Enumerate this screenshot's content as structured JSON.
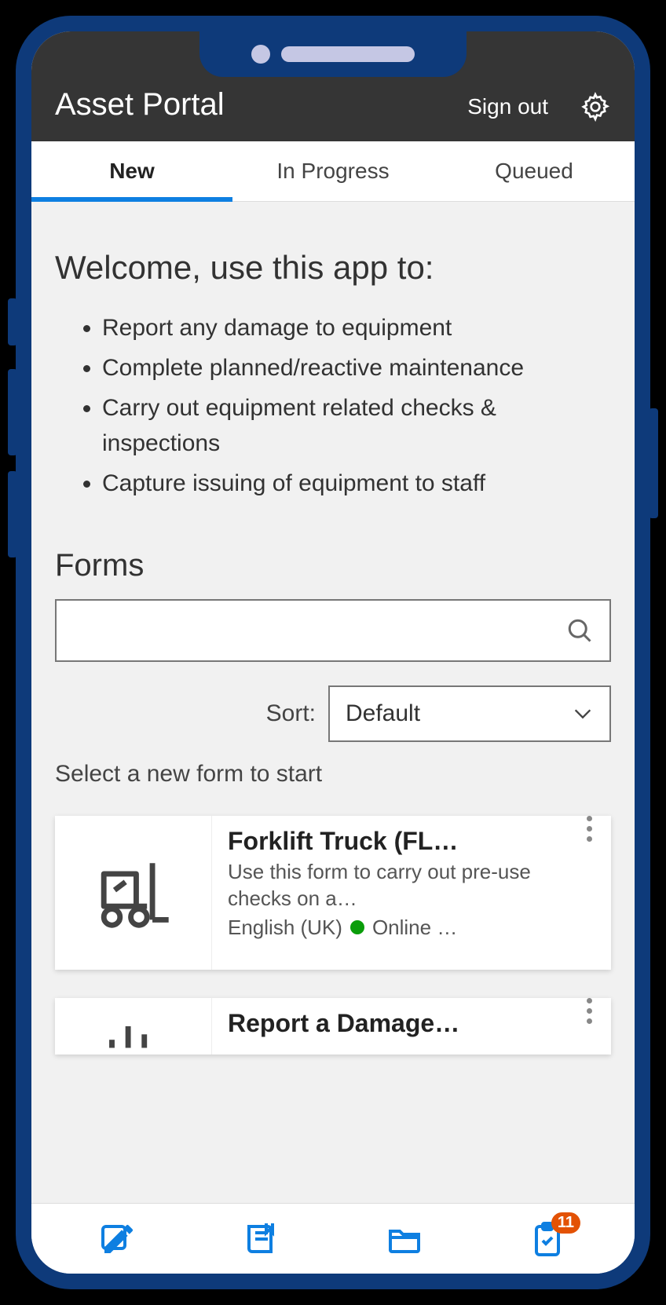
{
  "header": {
    "title": "Asset Portal",
    "signout": "Sign out"
  },
  "tabs": [
    {
      "label": "New",
      "active": true
    },
    {
      "label": "In Progress",
      "active": false
    },
    {
      "label": "Queued",
      "active": false
    }
  ],
  "welcome": {
    "heading": "Welcome, use this app to:",
    "bullets": [
      "Report any damage to equipment",
      "Complete planned/reactive maintenance",
      "Carry out equipment related checks & inspections",
      "Capture issuing of equipment to staff"
    ]
  },
  "forms": {
    "heading": "Forms",
    "sort_label": "Sort:",
    "sort_value": "Default",
    "instruction": "Select a new form to start",
    "cards": [
      {
        "title": "Forklift Truck (FL…",
        "desc": "Use this form to carry out pre-use checks on a…",
        "lang": "English (UK)",
        "status": "Online …"
      },
      {
        "title": "Report a Damage…",
        "desc": "",
        "lang": "",
        "status": ""
      }
    ]
  },
  "bottom_nav": {
    "badge": "11"
  }
}
